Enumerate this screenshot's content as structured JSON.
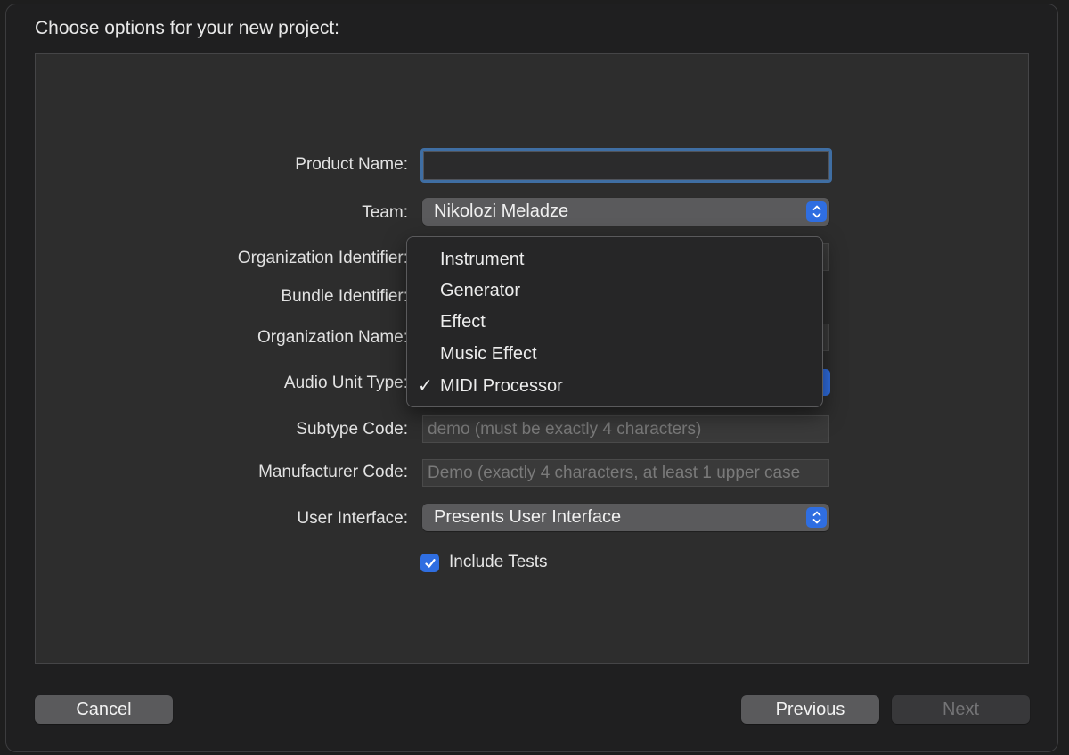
{
  "dialog": {
    "title": "Choose options for your new project:"
  },
  "form": {
    "product_name": {
      "label": "Product Name:",
      "value": ""
    },
    "team": {
      "label": "Team:",
      "value": "Nikolozi Meladze"
    },
    "organization_identifier": {
      "label": "Organization Identifier:"
    },
    "bundle_identifier": {
      "label": "Bundle Identifier:"
    },
    "organization_name": {
      "label": "Organization Name:"
    },
    "audio_unit_type": {
      "label": "Audio Unit Type:"
    },
    "subtype_code": {
      "label": "Subtype Code:",
      "placeholder": "demo (must be exactly 4 characters)"
    },
    "manufacturer_code": {
      "label": "Manufacturer Code:",
      "placeholder": "Demo (exactly 4 characters, at least 1 upper case"
    },
    "user_interface": {
      "label": "User Interface:",
      "value": "Presents User Interface"
    },
    "include_tests": {
      "label": "Include Tests",
      "checked": true
    }
  },
  "audio_unit_menu": {
    "items": [
      {
        "label": "Instrument",
        "checked": false
      },
      {
        "label": "Generator",
        "checked": false
      },
      {
        "label": "Effect",
        "checked": false
      },
      {
        "label": "Music Effect",
        "checked": false
      },
      {
        "label": "MIDI Processor",
        "checked": true
      }
    ],
    "check_glyph": "✓"
  },
  "footer": {
    "cancel_label": "Cancel",
    "previous_label": "Previous",
    "next_label": "Next"
  },
  "colors": {
    "accent": "#2f6ee1",
    "focus_ring": "#3f6ea3",
    "panel": "#2d2d2d",
    "window": "#1f1f20"
  },
  "icons": {
    "popup_stepper": "up-down-chevron-icon",
    "checkbox": "checkmark-icon"
  }
}
